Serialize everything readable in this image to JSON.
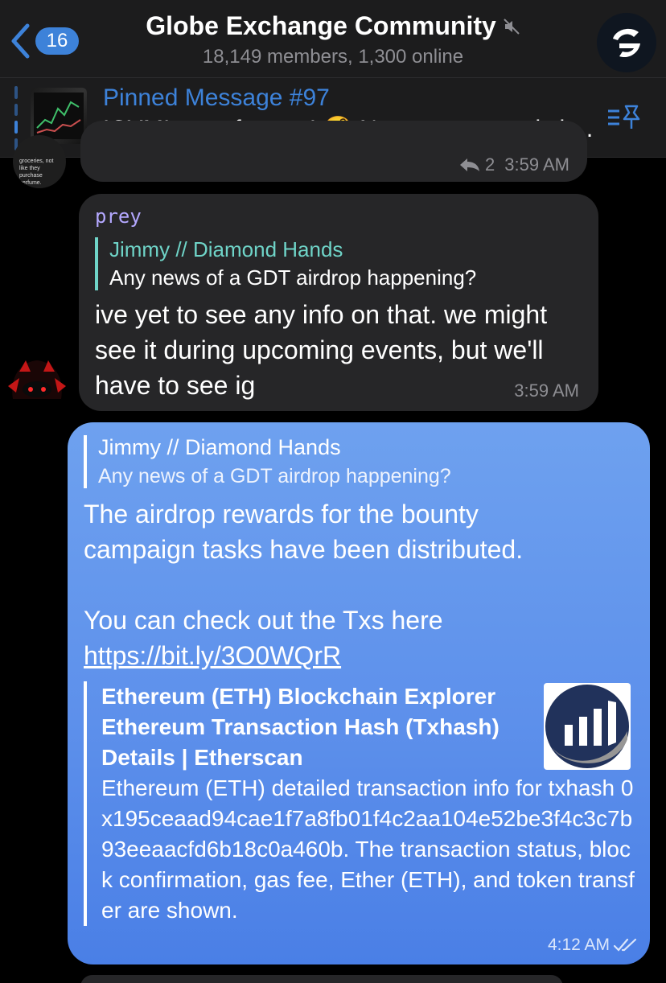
{
  "header": {
    "back_count": "16",
    "title": "Globe Exchange Community",
    "subtitle": "18,149 members, 1,300 online"
  },
  "pinned": {
    "title": "Pinned Message #97",
    "text": "ICYMI: new feature! 🧐 Now you can switch..."
  },
  "previous_message": {
    "avatar_text": "groceries, not like they purchase perfume.",
    "replies": "2",
    "time": "3:59 AM"
  },
  "message_prey": {
    "sender": "prey",
    "reply_name": "Jimmy // Diamond Hands",
    "reply_text": "Any news of a GDT airdrop happening?",
    "body": "ive yet to see any info on that. we might see it during upcoming events, but we'll have to see ig",
    "time": "3:59 AM"
  },
  "message_own": {
    "reply_name": "Jimmy // Diamond Hands",
    "reply_text": "Any news of a GDT airdrop happening?",
    "line1": "The airdrop rewards for the bounty campaign tasks have been distributed.",
    "line2": "You can check out the Txs here",
    "link": "https://bit.ly/3O0WQrR",
    "preview_title": "Ethereum (ETH) Blockchain Explorer Ethereum Transaction Hash (Txhash) Details | Etherscan",
    "preview_desc": "Ethereum (ETH) detailed transaction info for txhash 0x195ceaad94cae1f7a8fb01f4c2aa104e52be3f4c3c7b93eeaacfd6b18c0a460b. The transaction status, block confirmation, gas fee, Ether (ETH), and token transfer are shown.",
    "time": "4:12 AM"
  },
  "icons": {
    "back": "chevron-left-icon",
    "mute": "muted-icon",
    "pin_list": "pin-list-icon",
    "reply": "reply-arrow-icon",
    "read": "double-check-icon"
  },
  "colors": {
    "accent": "#3d82d9",
    "outgoing_bubble": "#5d90eb",
    "incoming_bubble": "#262628",
    "reply_accent": "#6fd4c8"
  }
}
